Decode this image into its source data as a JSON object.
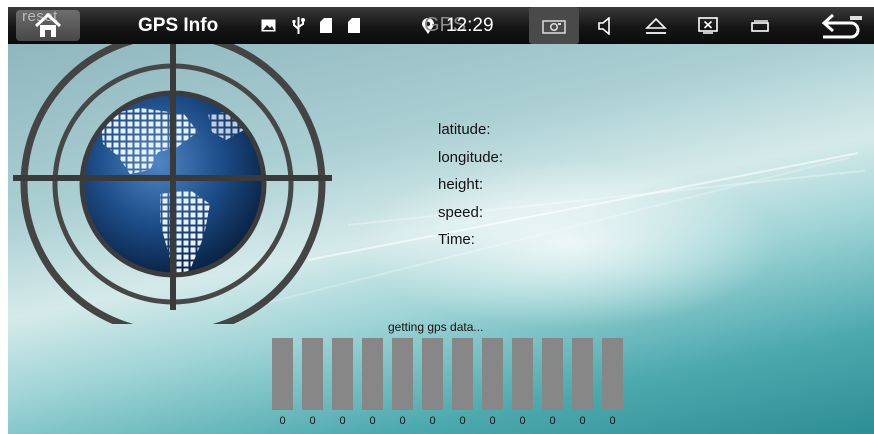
{
  "status_bar": {
    "home_label": "reset",
    "title": "GPS Info",
    "gps_label": "GPS",
    "time": "12:29",
    "icons": [
      "home-icon",
      "image-icon",
      "usb-icon",
      "sd-card-icon",
      "sd-card-icon",
      "location-pin-icon",
      "camera-icon",
      "volume-icon",
      "eject-icon",
      "screen-off-icon",
      "recent-apps-icon",
      "back-arrow-icon"
    ]
  },
  "info": {
    "latitude_label": "latitude:",
    "longitude_label": "longitude:",
    "height_label": "height:",
    "speed_label": "speed:",
    "time_label": "Time:"
  },
  "status_message": "getting gps data...",
  "signal_bars": [
    "0",
    "0",
    "0",
    "0",
    "0",
    "0",
    "0",
    "0",
    "0",
    "0",
    "0",
    "0"
  ],
  "colors": {
    "status_bar": "#151515",
    "bar": "#878787",
    "background_teal": "#3ea0a6",
    "globe_blue": "#1d4f8a",
    "ring": "#444444"
  }
}
